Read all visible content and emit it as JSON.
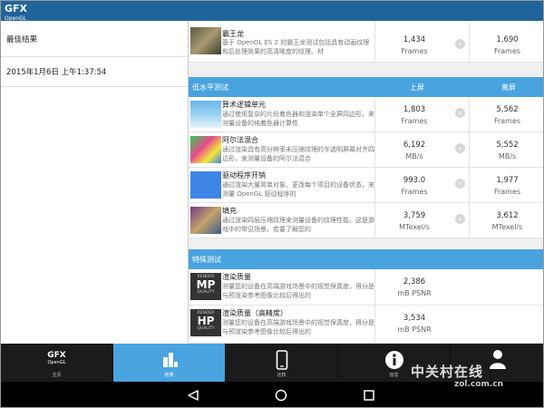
{
  "app": {
    "logo_main": "GFX",
    "logo_sub": "OpenGL"
  },
  "left": {
    "title": "最佳结果",
    "timestamp": "2015年1月6日 上午1:37:54"
  },
  "top_item": {
    "title": "霸王龙",
    "desc": "基于 OpenGL ES 2 的霸王龙测试包括具有动画纹理和后处理效果的高清晰度的纹理、材",
    "onscreen": "1,434",
    "onscreen_unit": "Frames",
    "offscreen": "1,690",
    "offscreen_unit": "Frames"
  },
  "section_low": {
    "label": "低水平测试",
    "h_onscreen": "上屏",
    "h_offscreen": "离屏"
  },
  "low_items": [
    {
      "title": "算术逻辑单元",
      "desc": "通过使用复杂的片段着色器和渲染单个全屏四边形，来测量设备的纯着色器计算性",
      "on": "1,803",
      "on_unit": "Frames",
      "off": "5,562",
      "off_unit": "Frames"
    },
    {
      "title": "阿尔法混合",
      "desc": "通过渲染具有高分辨率未压缩纹理的半透明屏幕对齐四边形，来测量设备的阿尔法混合",
      "on": "6,192",
      "on_unit": "MB/s",
      "off": "5,552",
      "off_unit": "MB/s"
    },
    {
      "title": "驱动程序开销",
      "desc": "通过渲染大量简单对象、更改每个项目的设备状态，来测量 OpenGL 驱动程序的",
      "on": "993.0",
      "on_unit": "Frames",
      "off": "1,977",
      "off_unit": "Frames"
    },
    {
      "title": "填充",
      "desc": "通过渲染四层压缩纹理来测量设备的纹理性能。这是游戏中的常见场景，若要了解您的",
      "on": "3,759",
      "on_unit": "MTexel/s",
      "off": "3,612",
      "off_unit": "MTexel/s"
    }
  ],
  "section_special": {
    "label": "特殊测试"
  },
  "special_items": [
    {
      "title": "渲染质量",
      "desc": "测量您的设备在高端游戏场景中的视觉保真度，得分是与预渲染参考图像比较后得出的",
      "value": "2,386",
      "unit": "mB PSNR",
      "badge_top": "RENDER",
      "badge_main": "MP",
      "badge_bottom": "QUALITY"
    },
    {
      "title": "渲染质量（高精度）",
      "desc": "测量您的设备在高端游戏场景中的视觉保真度，得分是与预渲染参考图像比较后得出的",
      "value": "3,534",
      "unit": "mB PSNR",
      "badge_top": "RENDER",
      "badge_main": "HP",
      "badge_bottom": "QUALITY"
    }
  ],
  "nav": [
    {
      "label": "主页",
      "icon": "gfx-logo-icon"
    },
    {
      "label": "结果",
      "icon": "bar-chart-icon"
    },
    {
      "label": "比较",
      "icon": "phone-icon"
    },
    {
      "label": "信息",
      "icon": "info-icon"
    },
    {
      "label": "",
      "icon": "user-icon"
    }
  ],
  "watermark": {
    "main": "中关村在线",
    "url": "zol.com.cn"
  },
  "colors": {
    "topbar": "#21649b",
    "accent": "#49a3df",
    "nav_bg": "#1b1b1b"
  }
}
